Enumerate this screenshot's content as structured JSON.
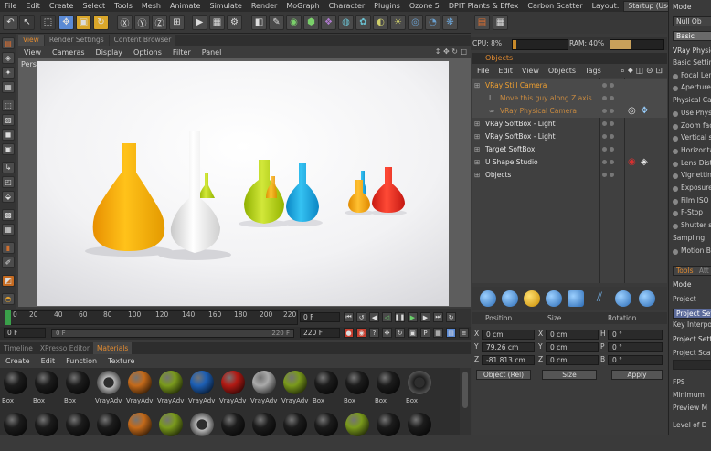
{
  "menubar": {
    "items": [
      "File",
      "Edit",
      "Create",
      "Select",
      "Tools",
      "Mesh",
      "Animate",
      "Simulate",
      "Render",
      "MoGraph",
      "Character",
      "Plugins",
      "Ozone 5",
      "DPIT Plants & Effex",
      "Carbon Scatter"
    ],
    "layout_label": "Layout:",
    "layout_value": "Startup (User)"
  },
  "viewport": {
    "tabs": [
      "View",
      "Render Settings",
      "Content Browser"
    ],
    "menu": [
      "View",
      "Cameras",
      "Display",
      "Options",
      "Filter",
      "Panel"
    ],
    "nav_icons": "↕ ✥ ↻ □",
    "label": "Perspective"
  },
  "timeline": {
    "ticks": [
      "0",
      "20",
      "40",
      "60",
      "80",
      "100",
      "120",
      "140",
      "160",
      "180",
      "200",
      "220"
    ],
    "current_frame": "0 F",
    "start_frame": "0 F",
    "range_start": "0 F",
    "range_end": "220 F",
    "end_frame": "220 F",
    "max_frame": "220 F"
  },
  "materials": {
    "tabs": [
      "Timeline",
      "XPresso Editor",
      "Materials"
    ],
    "menu": [
      "Create",
      "Edit",
      "Function",
      "Texture"
    ],
    "row1": [
      {
        "label": "Box",
        "color": "#1c1c1c"
      },
      {
        "label": "Box",
        "color": "#1c1c1c"
      },
      {
        "label": "Box",
        "color": "#1c1c1c"
      },
      {
        "label": "VrayAdv",
        "color": "#bbbbbb",
        "knot": true
      },
      {
        "label": "VrayAdv",
        "color": "#c46a1a"
      },
      {
        "label": "VrayAdv",
        "color": "#7a9a1c"
      },
      {
        "label": "VrayAdv",
        "color": "#1d5fb4"
      },
      {
        "label": "VrayAdv",
        "color": "#b21a14"
      },
      {
        "label": "VrayAdv",
        "color": "#aaaaaa"
      },
      {
        "label": "VrayAdv",
        "color": "#7a9a1c"
      },
      {
        "label": "Box",
        "color": "#1c1c1c"
      },
      {
        "label": "Box",
        "color": "#1c1c1c"
      },
      {
        "label": "Box",
        "color": "#1c1c1c"
      },
      {
        "label": "Box",
        "color": "#1c1c1c",
        "knot": true
      }
    ],
    "row2": [
      {
        "color": "#1c1c1c"
      },
      {
        "color": "#1c1c1c"
      },
      {
        "color": "#1c1c1c"
      },
      {
        "color": "#1c1c1c"
      },
      {
        "color": "#c46a1a"
      },
      {
        "color": "#7a9a1c"
      },
      {
        "color": "#bbbbbb",
        "knot": true
      },
      {
        "color": "#1c1c1c"
      },
      {
        "color": "#1c1c1c"
      },
      {
        "color": "#1c1c1c"
      },
      {
        "color": "#1c1c1c"
      },
      {
        "color": "#7a9a1c"
      },
      {
        "color": "#1c1c1c"
      },
      {
        "color": "#1c1c1c"
      }
    ]
  },
  "stats": {
    "cpu": "CPU: 8%",
    "ram": "RAM: 40%"
  },
  "objects": {
    "title": "Objects",
    "menu": [
      "File",
      "Edit",
      "View",
      "Objects",
      "Tags"
    ],
    "rows": [
      {
        "name": "VRay Still Camera",
        "style": "orange",
        "indent": 14,
        "prefix": "⊞"
      },
      {
        "name": "Move this guy along Z axis",
        "style": "dimorange",
        "indent": 30,
        "prefix": "L"
      },
      {
        "name": "VRay Physical Camera",
        "style": "dimorange",
        "indent": 30,
        "prefix": "∞"
      },
      {
        "name": "VRay SoftBox - Light",
        "style": "white",
        "indent": 14,
        "prefix": "⊞"
      },
      {
        "name": "VRay SoftBox - Light",
        "style": "white",
        "indent": 14,
        "prefix": "⊞"
      },
      {
        "name": "Target SoftBox",
        "style": "white",
        "indent": 14,
        "prefix": "⊞"
      },
      {
        "name": "U Shape Studio",
        "style": "white",
        "indent": 14,
        "prefix": "⊞"
      },
      {
        "name": "Objects",
        "style": "white",
        "indent": 14,
        "prefix": "⊞"
      }
    ]
  },
  "coords": {
    "headers": [
      "Position",
      "Size",
      "Rotation"
    ],
    "rows": [
      {
        "axis": "X",
        "pos": "0 cm",
        "saxis": "X",
        "size": "0 cm",
        "raxis": "H",
        "rot": "0 °"
      },
      {
        "axis": "Y",
        "pos": "79.26 cm",
        "saxis": "Y",
        "size": "0 cm",
        "raxis": "P",
        "rot": "0 °"
      },
      {
        "axis": "Z",
        "pos": "-81.813 cm",
        "saxis": "Z",
        "size": "0 cm",
        "raxis": "B",
        "rot": "0 °"
      }
    ],
    "mode": "Object (Rel)",
    "size_mode": "Size",
    "apply": "Apply"
  },
  "attributes": {
    "mode": "Mode",
    "null_label": "Null Ob",
    "basic": "Basic",
    "section": "VRay Physical",
    "items": [
      "Basic Setting",
      "Focal Len",
      "Aperture V",
      "Physical Cam",
      "Use Physi",
      "Zoom fact",
      "Vertical sh",
      "Horizontal",
      "Lens Disto",
      "Vignetting",
      "Exposure",
      "Film ISO",
      "F-Stop",
      "Shutter sp",
      "Sampling",
      "Motion Bl"
    ],
    "tabs": [
      "Tools",
      "Att"
    ],
    "mode2": "Mode",
    "project": "Project",
    "project_sett": "Project Sett",
    "key_interp": "Key Interpo",
    "project_sett2": "Project Sett",
    "project_scale": "Project Scal",
    "fps": "FPS",
    "minimum": "Minimum",
    "preview_m": "Preview M",
    "level_of": "Level of D"
  }
}
